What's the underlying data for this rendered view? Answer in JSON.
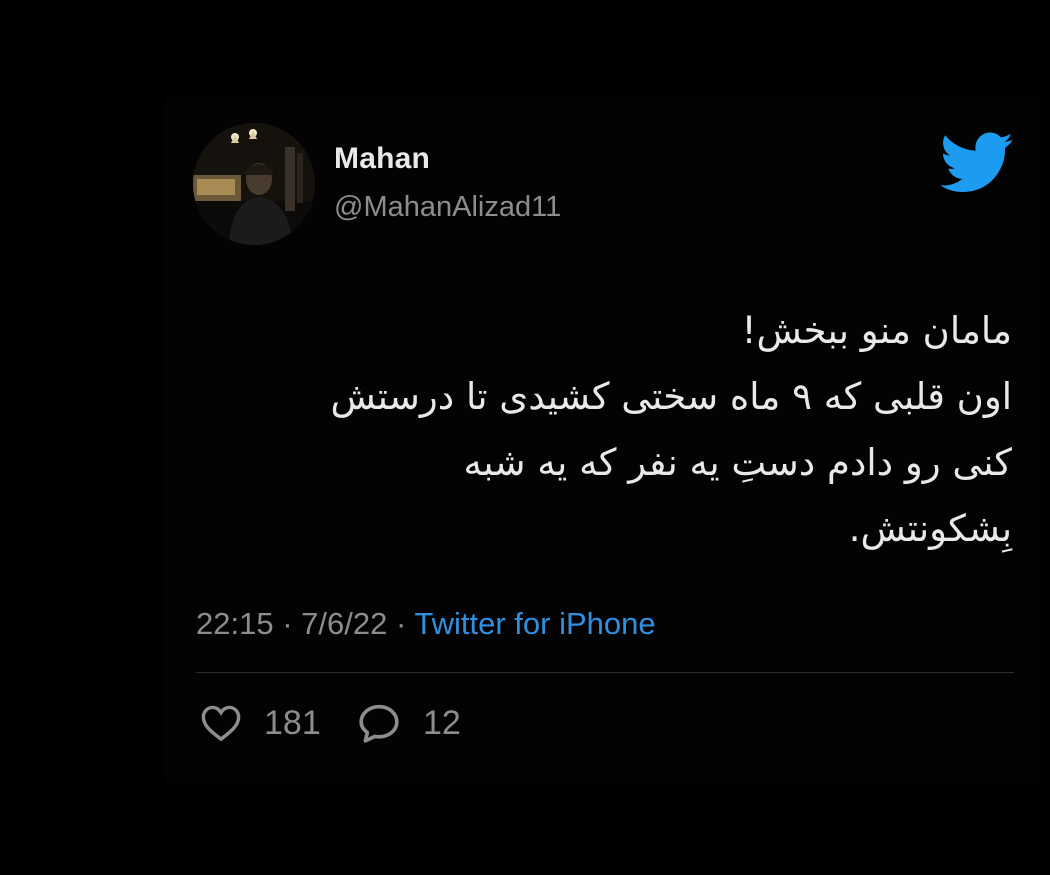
{
  "author": {
    "display_name": "Mahan",
    "handle": "@MahanAlizad11"
  },
  "tweet": {
    "lines": [
      "مامان منو ببخش!",
      "اون قلبی که ۹ ماه سختی کشیدی تا درستش",
      "کنی رو دادم دستِ یه نفر که یه شبه",
      "بِشکونتش."
    ]
  },
  "meta": {
    "time": "22:15",
    "date": "7/6/22",
    "separator": "·",
    "source": "Twitter for iPhone"
  },
  "stats": {
    "likes": "181",
    "replies": "12"
  },
  "icons": {
    "brand": "twitter-bird-icon",
    "like": "heart-icon",
    "reply": "comment-icon"
  },
  "colors": {
    "background": "#000000",
    "text": "#e7e9ea",
    "secondary_text": "#8b8d91",
    "link": "#2f8fe0",
    "brand_blue": "#1d9bf0"
  }
}
